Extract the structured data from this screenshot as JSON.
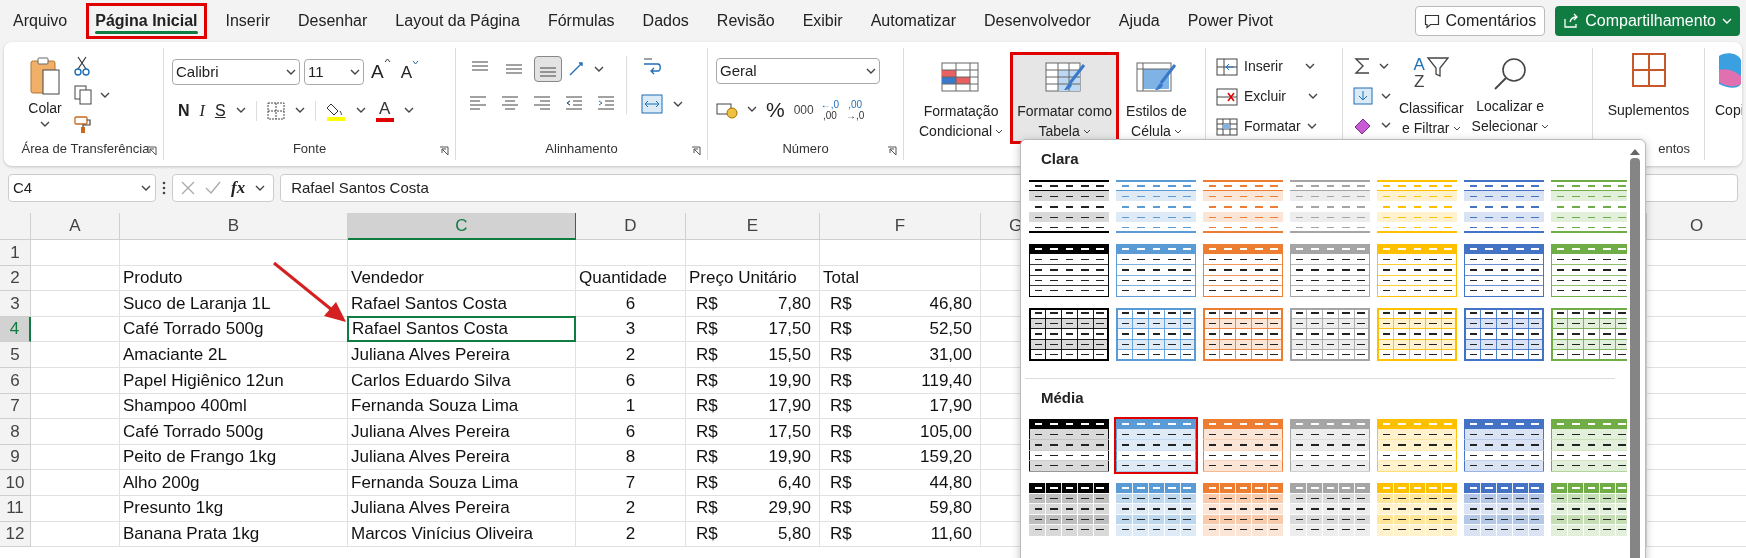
{
  "menu_tabs": [
    {
      "label": "Arquivo",
      "selected": false,
      "annotated": false
    },
    {
      "label": "Página Inicial",
      "selected": true,
      "annotated": true
    },
    {
      "label": "Inserir",
      "selected": false,
      "annotated": false
    },
    {
      "label": "Desenhar",
      "selected": false,
      "annotated": false
    },
    {
      "label": "Layout da Página",
      "selected": false,
      "annotated": false
    },
    {
      "label": "Fórmulas",
      "selected": false,
      "annotated": false
    },
    {
      "label": "Dados",
      "selected": false,
      "annotated": false
    },
    {
      "label": "Revisão",
      "selected": false,
      "annotated": false
    },
    {
      "label": "Exibir",
      "selected": false,
      "annotated": false
    },
    {
      "label": "Automatizar",
      "selected": false,
      "annotated": false
    },
    {
      "label": "Desenvolvedor",
      "selected": false,
      "annotated": false
    },
    {
      "label": "Ajuda",
      "selected": false,
      "annotated": false
    },
    {
      "label": "Power Pivot",
      "selected": false,
      "annotated": false
    }
  ],
  "comments_button": "Comentários",
  "share_button": "Compartilhamento",
  "ribbon": {
    "clipboard": {
      "paste_label": "Colar",
      "group_label": "Área de Transferência"
    },
    "font": {
      "font_name": "Calibri",
      "font_size": "11",
      "grow": "A",
      "shrink": "A",
      "bold": "N",
      "italic": "I",
      "underline": "S",
      "font_color": "A",
      "group_label": "Fonte"
    },
    "alignment": {
      "vertical": [
        {
          "kind": "top",
          "selected": false
        },
        {
          "kind": "middle",
          "selected": false
        },
        {
          "kind": "bottom",
          "selected": true
        }
      ],
      "group_label": "Alinhamento"
    },
    "number": {
      "format": "Geral",
      "percent": "%",
      "thousands": "000",
      "decimals": [
        {
          "top": "←,0",
          "bottom": ",00"
        },
        {
          "top": ",00",
          "bottom": "→,0"
        }
      ],
      "group_label": "Número"
    },
    "styles": [
      {
        "line1": "Formatação",
        "line2": "Condicional",
        "pressed": false,
        "annotated": false
      },
      {
        "line1": "Formatar como",
        "line2": "Tabela",
        "pressed": true,
        "annotated": true
      },
      {
        "line1": "Estilos de",
        "line2": "Célula",
        "pressed": false,
        "annotated": false
      }
    ],
    "cells": [
      {
        "kind": "insert",
        "label": "Inserir"
      },
      {
        "kind": "delete",
        "label": "Excluir"
      },
      {
        "kind": "format",
        "label": "Formatar"
      }
    ],
    "editing": {
      "sort_letters": [
        "A",
        "Z"
      ],
      "sort": {
        "line1": "Classificar",
        "line2": "e Filtrar"
      },
      "find": {
        "line1": "Localizar e",
        "line2": "Selecionar"
      }
    },
    "addins": {
      "label": "Suplementos",
      "group_label": "entos"
    },
    "copilot_label": "Copi"
  },
  "formula_bar": {
    "name_box": "C4",
    "function_label": "fx",
    "formula": "Rafael Santos Costa"
  },
  "sheet": {
    "columns": [
      {
        "letter": "A",
        "selected": false
      },
      {
        "letter": "B",
        "selected": false
      },
      {
        "letter": "C",
        "selected": true
      },
      {
        "letter": "D",
        "selected": false
      },
      {
        "letter": "E",
        "selected": false
      },
      {
        "letter": "F",
        "selected": false
      },
      {
        "letter": "G",
        "selected": false
      },
      {
        "letter": "O",
        "selected": false
      }
    ],
    "rows": [
      {
        "number": "1",
        "selected": false
      },
      {
        "number": "2",
        "selected": false,
        "cells": [
          {
            "kind": "empty"
          },
          {
            "kind": "text",
            "text": "Produto"
          },
          {
            "kind": "text",
            "text": "Vendedor"
          },
          {
            "kind": "text",
            "text": "Quantidade"
          },
          {
            "kind": "text",
            "text": "Preço Unitário"
          },
          {
            "kind": "text",
            "text": "Total"
          }
        ]
      },
      {
        "number": "3",
        "selected": false,
        "cells": [
          {
            "kind": "empty"
          },
          {
            "kind": "text",
            "text": "Suco de Laranja 1L"
          },
          {
            "kind": "text",
            "text": "Rafael Santos Costa"
          },
          {
            "kind": "number",
            "text": "6"
          },
          {
            "kind": "currency",
            "symbol": "R$",
            "text": "7,80"
          },
          {
            "kind": "currency",
            "symbol": "R$",
            "text": "46,80"
          }
        ]
      },
      {
        "number": "4",
        "selected": true,
        "cells": [
          {
            "kind": "empty"
          },
          {
            "kind": "text",
            "text": "Café Torrado 500g"
          },
          {
            "kind": "text",
            "text": "Rafael Santos Costa"
          },
          {
            "kind": "number",
            "text": "3"
          },
          {
            "kind": "currency",
            "symbol": "R$",
            "text": "17,50"
          },
          {
            "kind": "currency",
            "symbol": "R$",
            "text": "52,50"
          }
        ]
      },
      {
        "number": "5",
        "selected": false,
        "cells": [
          {
            "kind": "empty"
          },
          {
            "kind": "text",
            "text": "Amaciante 2L"
          },
          {
            "kind": "text",
            "text": "Juliana Alves Pereira"
          },
          {
            "kind": "number",
            "text": "2"
          },
          {
            "kind": "currency",
            "symbol": "R$",
            "text": "15,50"
          },
          {
            "kind": "currency",
            "symbol": "R$",
            "text": "31,00"
          }
        ]
      },
      {
        "number": "6",
        "selected": false,
        "cells": [
          {
            "kind": "empty"
          },
          {
            "kind": "text",
            "text": "Papel Higiênico 12un"
          },
          {
            "kind": "text",
            "text": "Carlos Eduardo Silva"
          },
          {
            "kind": "number",
            "text": "6"
          },
          {
            "kind": "currency",
            "symbol": "R$",
            "text": "19,90"
          },
          {
            "kind": "currency",
            "symbol": "R$",
            "text": "119,40"
          }
        ]
      },
      {
        "number": "7",
        "selected": false,
        "cells": [
          {
            "kind": "empty"
          },
          {
            "kind": "text",
            "text": "Shampoo 400ml"
          },
          {
            "kind": "text",
            "text": "Fernanda Souza Lima"
          },
          {
            "kind": "number",
            "text": "1"
          },
          {
            "kind": "currency",
            "symbol": "R$",
            "text": "17,90"
          },
          {
            "kind": "currency",
            "symbol": "R$",
            "text": "17,90"
          }
        ]
      },
      {
        "number": "8",
        "selected": false,
        "cells": [
          {
            "kind": "empty"
          },
          {
            "kind": "text",
            "text": "Café Torrado 500g"
          },
          {
            "kind": "text",
            "text": "Juliana Alves Pereira"
          },
          {
            "kind": "number",
            "text": "6"
          },
          {
            "kind": "currency",
            "symbol": "R$",
            "text": "17,50"
          },
          {
            "kind": "currency",
            "symbol": "R$",
            "text": "105,00"
          }
        ]
      },
      {
        "number": "9",
        "selected": false,
        "cells": [
          {
            "kind": "empty"
          },
          {
            "kind": "text",
            "text": "Peito de Frango 1kg"
          },
          {
            "kind": "text",
            "text": "Juliana Alves Pereira"
          },
          {
            "kind": "number",
            "text": "8"
          },
          {
            "kind": "currency",
            "symbol": "R$",
            "text": "19,90"
          },
          {
            "kind": "currency",
            "symbol": "R$",
            "text": "159,20"
          }
        ]
      },
      {
        "number": "10",
        "selected": false,
        "cells": [
          {
            "kind": "empty"
          },
          {
            "kind": "text",
            "text": "Alho 200g"
          },
          {
            "kind": "text",
            "text": "Fernanda Souza Lima"
          },
          {
            "kind": "number",
            "text": "7"
          },
          {
            "kind": "currency",
            "symbol": "R$",
            "text": "6,40"
          },
          {
            "kind": "currency",
            "symbol": "R$",
            "text": "44,80"
          }
        ]
      },
      {
        "number": "11",
        "selected": false,
        "cells": [
          {
            "kind": "empty"
          },
          {
            "kind": "text",
            "text": "Presunto 1kg"
          },
          {
            "kind": "text",
            "text": "Juliana Alves Pereira"
          },
          {
            "kind": "number",
            "text": "2"
          },
          {
            "kind": "currency",
            "symbol": "R$",
            "text": "29,90"
          },
          {
            "kind": "currency",
            "symbol": "R$",
            "text": "59,80"
          }
        ]
      },
      {
        "number": "12",
        "selected": false,
        "cells": [
          {
            "kind": "empty"
          },
          {
            "kind": "text",
            "text": "Banana Prata 1kg"
          },
          {
            "kind": "text",
            "text": "Marcos Vinícius Oliveira"
          },
          {
            "kind": "number",
            "text": "2"
          },
          {
            "kind": "currency",
            "symbol": "R$",
            "text": "5,80"
          },
          {
            "kind": "currency",
            "symbol": "R$",
            "text": "11,60"
          }
        ]
      }
    ]
  },
  "gallery": {
    "sections": [
      {
        "title": "Clara",
        "rows": [
          {
            "kind": "lines",
            "styles": [
              {
                "color": "#000000",
                "annotated": false
              },
              {
                "color": "#5b9bd5",
                "annotated": false
              },
              {
                "color": "#ed7d31",
                "annotated": false
              },
              {
                "color": "#a5a5a5",
                "annotated": false
              },
              {
                "color": "#ffc000",
                "annotated": false
              },
              {
                "color": "#4472c4",
                "annotated": false
              },
              {
                "color": "#70ad47",
                "annotated": false
              }
            ]
          },
          {
            "kind": "header",
            "styles": [
              {
                "color": "#000000",
                "annotated": false
              },
              {
                "color": "#5b9bd5",
                "annotated": false
              },
              {
                "color": "#ed7d31",
                "annotated": false
              },
              {
                "color": "#a5a5a5",
                "annotated": false
              },
              {
                "color": "#ffc000",
                "annotated": false
              },
              {
                "color": "#4472c4",
                "annotated": false
              },
              {
                "color": "#70ad47",
                "annotated": false
              }
            ]
          },
          {
            "kind": "grid",
            "styles": [
              {
                "color": "#000000",
                "annotated": false
              },
              {
                "color": "#5b9bd5",
                "annotated": false
              },
              {
                "color": "#ed7d31",
                "annotated": false
              },
              {
                "color": "#a5a5a5",
                "annotated": false
              },
              {
                "color": "#ffc000",
                "annotated": false
              },
              {
                "color": "#4472c4",
                "annotated": false
              },
              {
                "color": "#70ad47",
                "annotated": false
              }
            ]
          }
        ]
      },
      {
        "title": "Média",
        "rows": [
          {
            "kind": "banded",
            "styles": [
              {
                "color": "#000000",
                "annotated": false
              },
              {
                "color": "#5b9bd5",
                "annotated": true
              },
              {
                "color": "#ed7d31",
                "annotated": false
              },
              {
                "color": "#a5a5a5",
                "annotated": false
              },
              {
                "color": "#ffc000",
                "annotated": false
              },
              {
                "color": "#4472c4",
                "annotated": false
              },
              {
                "color": "#70ad47",
                "annotated": false
              }
            ]
          },
          {
            "kind": "banded-grid",
            "styles": [
              {
                "color": "#000000",
                "annotated": false
              },
              {
                "color": "#5b9bd5",
                "annotated": false
              },
              {
                "color": "#ed7d31",
                "annotated": false
              },
              {
                "color": "#a5a5a5",
                "annotated": false
              },
              {
                "color": "#ffc000",
                "annotated": false
              },
              {
                "color": "#4472c4",
                "annotated": false
              },
              {
                "color": "#70ad47",
                "annotated": false
              }
            ]
          }
        ]
      }
    ]
  }
}
